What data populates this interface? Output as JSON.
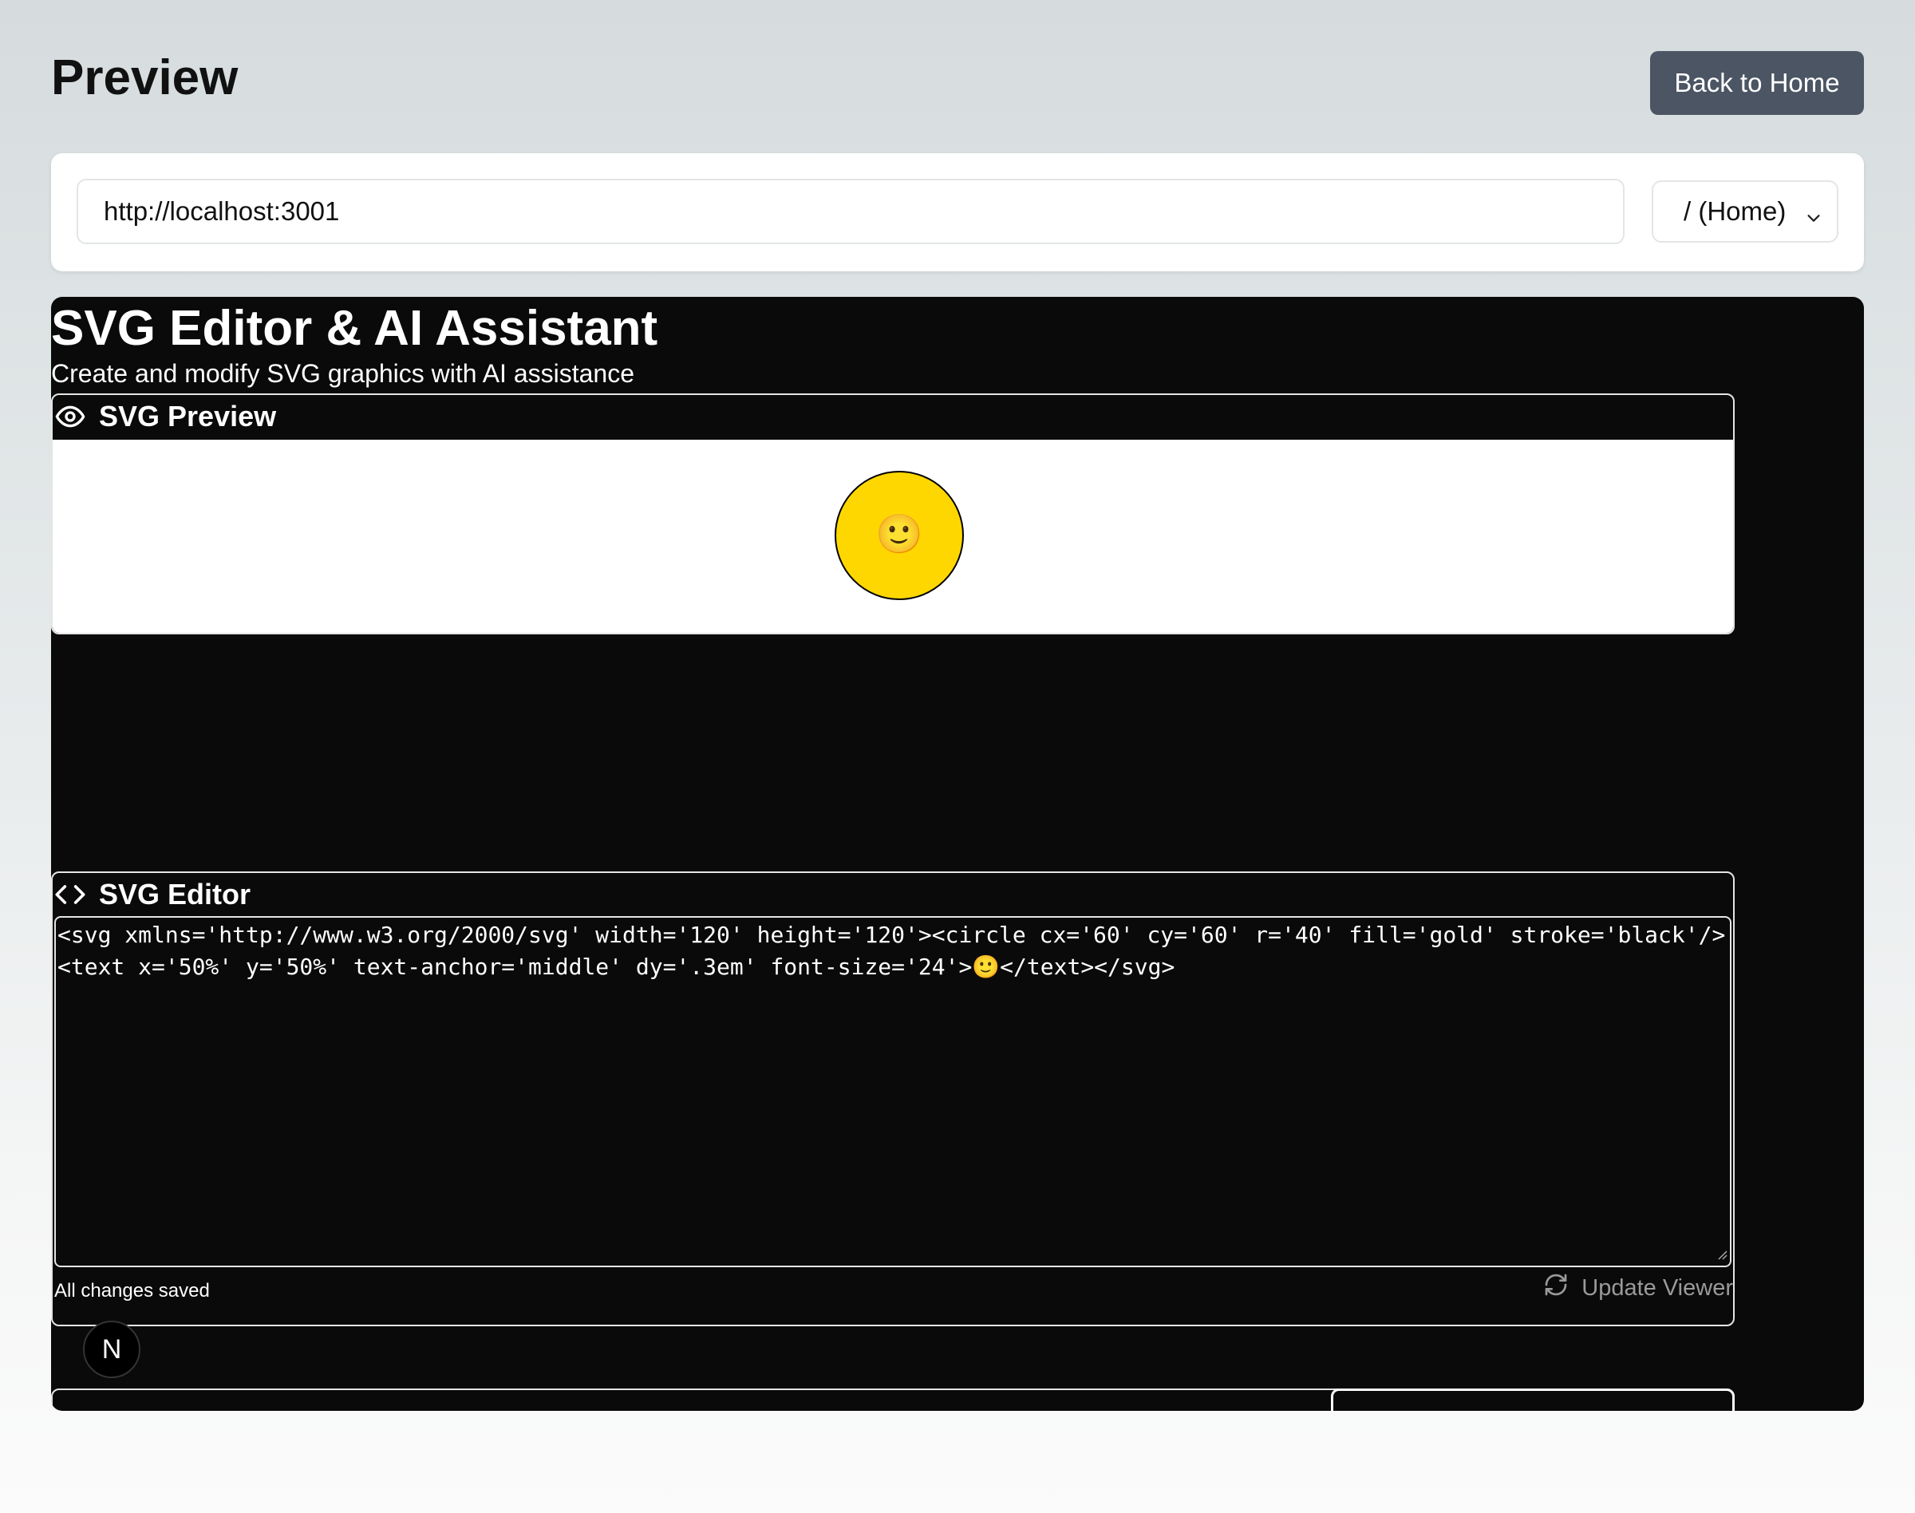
{
  "header": {
    "title": "Preview",
    "back_button_label": "Back to Home"
  },
  "address_bar": {
    "url": "http://localhost:3001",
    "route_selected": "/ (Home)"
  },
  "app": {
    "title": "SVG Editor & AI Assistant",
    "subtitle": "Create and modify SVG graphics with AI assistance",
    "preview_panel": {
      "heading": "SVG Preview",
      "icon": "eye-icon",
      "circle_fill": "#ffd700",
      "emoji": "🙂"
    },
    "editor_panel": {
      "heading": "SVG Editor",
      "icon": "code-icon",
      "code": "<svg xmlns='http://www.w3.org/2000/svg' width='120' height='120'><circle cx='60' cy='60' r='40' fill='gold' stroke='black'/><text x='50%' y='50%' text-anchor='middle' dy='.3em' font-size='24'>🙂</text></svg>",
      "status": "All changes saved",
      "update_button_label": "Update Viewer",
      "update_icon": "refresh-icon"
    },
    "dev_badge": "N"
  },
  "colors": {
    "back_button_bg": "#4b5563",
    "frame_bg": "#0a0a0a",
    "accent_gold": "#ffd700"
  }
}
